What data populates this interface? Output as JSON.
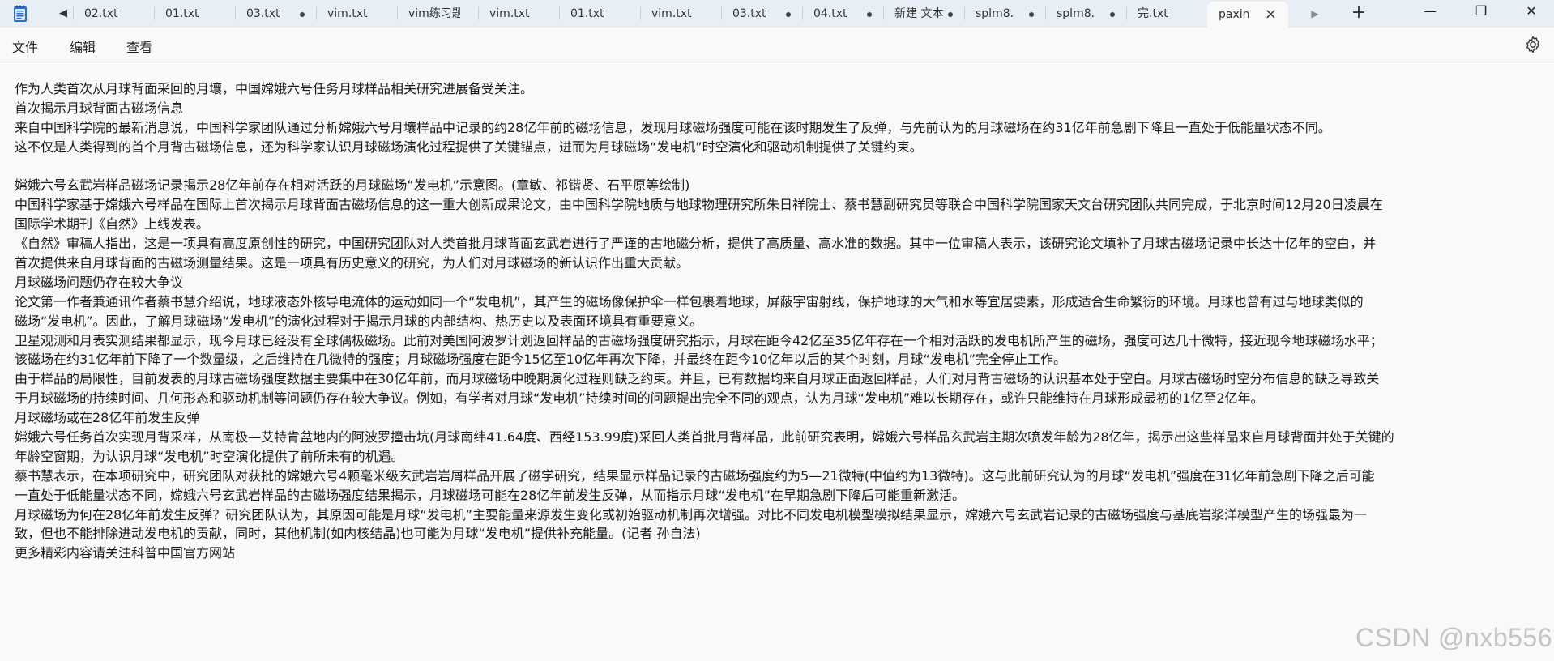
{
  "window": {
    "tabs": [
      {
        "label": "02.txt",
        "unsaved": false
      },
      {
        "label": "01.txt",
        "unsaved": false
      },
      {
        "label": "03.txt",
        "unsaved": true
      },
      {
        "label": "vim.txt",
        "unsaved": false
      },
      {
        "label": "vim练习题.txt",
        "unsaved": false
      },
      {
        "label": "vim.txt",
        "unsaved": false
      },
      {
        "label": "01.txt",
        "unsaved": false
      },
      {
        "label": "vim.txt",
        "unsaved": false
      },
      {
        "label": "03.txt",
        "unsaved": true
      },
      {
        "label": "04.txt",
        "unsaved": true
      },
      {
        "label": "新建 文本",
        "unsaved": true
      },
      {
        "label": "splm8.",
        "unsaved": true
      },
      {
        "label": "splm8.",
        "unsaved": true
      },
      {
        "label": "完.txt",
        "unsaved": false
      },
      {
        "label": "paxin",
        "active": true
      }
    ],
    "controls": {
      "minimize": "—",
      "maximize": "❐",
      "close": "✕"
    }
  },
  "menu": {
    "file": "文件",
    "edit": "编辑",
    "view": "查看"
  },
  "icons": {
    "app": "notepad-icon",
    "settings": "gear-icon",
    "scroll_left": "▶",
    "scroll_right": "▶",
    "new_tab": "+"
  },
  "document": {
    "lines": [
      "作为人类首次从月球背面采回的月壤，中国嫦娥六号任务月球样品相关研究进展备受关注。",
      "首次揭示月球背面古磁场信息",
      "来自中国科学院的最新消息说，中国科学家团队通过分析嫦娥六号月壤样品中记录的约28亿年前的磁场信息，发现月球磁场强度可能在该时期发生了反弹，与先前认为的月球磁场在约31亿年前急剧下降且一直处于低能量状态不同。",
      "这不仅是人类得到的首个月背古磁场信息，还为科学家认识月球磁场演化过程提供了关键锚点，进而为月球磁场“发电机”时空演化和驱动机制提供了关键约束。",
      "",
      "嫦娥六号玄武岩样品磁场记录揭示28亿年前存在相对活跃的月球磁场“发电机”示意图。(章敏、祁锴贤、石平原等绘制)",
      "中国科学家基于嫦娥六号样品在国际上首次揭示月球背面古磁场信息的这一重大创新成果论文，由中国科学院地质与地球物理研究所朱日祥院士、蔡书慧副研究员等联合中国科学院国家天文台研究团队共同完成，于北京时间12月20日凌晨在",
      "国际学术期刊《自然》上线发表。",
      "《自然》审稿人指出，这是一项具有高度原创性的研究，中国研究团队对人类首批月球背面玄武岩进行了严谨的古地磁分析，提供了高质量、高水准的数据。其中一位审稿人表示，该研究论文填补了月球古磁场记录中长达十亿年的空白，并",
      "首次提供来自月球背面的古磁场测量结果。这是一项具有历史意义的研究，为人们对月球磁场的新认识作出重大贡献。",
      "月球磁场问题仍存在较大争议",
      "论文第一作者兼通讯作者蔡书慧介绍说，地球液态外核导电流体的运动如同一个“发电机”，其产生的磁场像保护伞一样包裹着地球，屏蔽宇宙射线，保护地球的大气和水等宜居要素，形成适合生命繁衍的环境。月球也曾有过与地球类似的",
      "磁场“发电机”。因此，了解月球磁场“发电机”的演化过程对于揭示月球的内部结构、热历史以及表面环境具有重要意义。",
      "卫星观测和月表实测结果都显示，现今月球已经没有全球偶极磁场。此前对美国阿波罗计划返回样品的古磁场强度研究指示，月球在距今42亿至35亿年存在一个相对活跃的发电机所产生的磁场，强度可达几十微特，接近现今地球磁场水平；",
      "该磁场在约31亿年前下降了一个数量级，之后维持在几微特的强度；月球磁场强度在距今15亿至10亿年再次下降，并最终在距今10亿年以后的某个时刻，月球“发电机”完全停止工作。",
      "由于样品的局限性，目前发表的月球古磁场强度数据主要集中在30亿年前，而月球磁场中晚期演化过程则缺乏约束。并且，已有数据均来自月球正面返回样品，人们对月背古磁场的认识基本处于空白。月球古磁场时空分布信息的缺乏导致关",
      "于月球磁场的持续时间、几何形态和驱动机制等问题仍存在较大争议。例如，有学者对月球“发电机”持续时间的问题提出完全不同的观点，认为月球“发电机”难以长期存在，或许只能维持在月球形成最初的1亿至2亿年。",
      "月球磁场或在28亿年前发生反弹",
      "嫦娥六号任务首次实现月背采样，从南极—艾特肯盆地内的阿波罗撞击坑(月球南纬41.64度、西经153.99度)采回人类首批月背样品，此前研究表明，嫦娥六号样品玄武岩主期次喷发年龄为28亿年，揭示出这些样品来自月球背面并处于关键的",
      "年龄空窗期，为认识月球“发电机”时空演化提供了前所未有的机遇。",
      "蔡书慧表示，在本项研究中，研究团队对获批的嫦娥六号4颗毫米级玄武岩岩屑样品开展了磁学研究，结果显示样品记录的古磁场强度约为5—21微特(中值约为13微特)。这与此前研究认为的月球“发电机”强度在31亿年前急剧下降之后可能",
      "一直处于低能量状态不同，嫦娥六号玄武岩样品的古磁场强度结果揭示，月球磁场可能在28亿年前发生反弹，从而指示月球“发电机”在早期急剧下降后可能重新激活。",
      "月球磁场为何在28亿年前发生反弹？研究团队认为，其原因可能是月球“发电机”主要能量来源发生变化或初始驱动机制再次增强。对比不同发电机模型模拟结果显示，嫦娥六号玄武岩记录的古磁场强度与基底岩浆洋模型产生的场强最为一",
      "致，但也不能排除进动发电机的贡献，同时，其他机制(如内核结晶)也可能为月球“发电机”提供补充能量。(记者 孙自法)",
      "更多精彩内容请关注科普中国官方网站"
    ]
  },
  "watermark": "CSDN @nxb556"
}
